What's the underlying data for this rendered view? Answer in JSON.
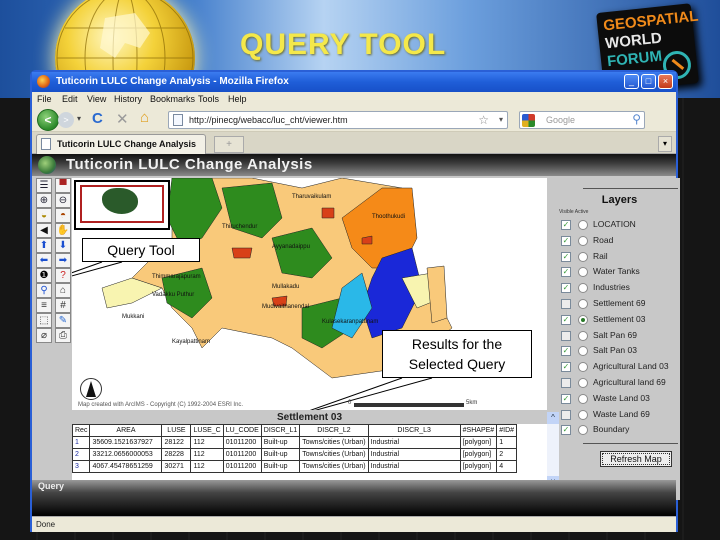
{
  "slide": {
    "title": "QUERY TOOL",
    "logo_lines": [
      "GEOSPATIAL",
      "WORLD",
      "FORUM"
    ],
    "colors": {
      "title": "#f4e84a",
      "logo_geo": "#f08a1a",
      "logo_world": "#e8e8e8",
      "logo_forum": "#2fb4b4"
    }
  },
  "browser": {
    "window_title": "Tuticorin LULC Change Analysis - Mozilla Firefox",
    "window_buttons": [
      "_",
      "□",
      "×"
    ],
    "menu": [
      "File",
      "Edit",
      "View",
      "History",
      "Bookmarks",
      "Tools",
      "Help"
    ],
    "nav": {
      "back": "<",
      "forward": ">",
      "dropdown": "▾",
      "reload": "C",
      "stop": "✕",
      "home": "⌂"
    },
    "url": "http://pinecg/webacc/luc_cht/viewer.htm",
    "bookmark_star": "☆",
    "search_placeholder": "Google",
    "tab_label": "Tuticorin LULC Change Analysis",
    "new_tab": "+",
    "tab_list": "▾",
    "status": "Done"
  },
  "app": {
    "title": "Tuticorin LULC Change Analysis",
    "footer_label": "Query",
    "toolbar": [
      {
        "name": "legend-toggle-icon",
        "glyph": "☰"
      },
      {
        "name": "overview-toggle-icon",
        "glyph": "▀"
      },
      {
        "name": "zoom-in-icon",
        "glyph": "⊕"
      },
      {
        "name": "zoom-out-icon",
        "glyph": "⊖"
      },
      {
        "name": "zoom-full-icon",
        "glyph": "◒"
      },
      {
        "name": "zoom-active-icon",
        "glyph": "◓"
      },
      {
        "name": "back-extent-icon",
        "glyph": "◀"
      },
      {
        "name": "pan-hand-icon",
        "glyph": "✋"
      },
      {
        "name": "pan-north-icon",
        "glyph": "⬆"
      },
      {
        "name": "pan-south-icon",
        "glyph": "⬇"
      },
      {
        "name": "pan-west-icon",
        "glyph": "⬅"
      },
      {
        "name": "pan-east-icon",
        "glyph": "➡"
      },
      {
        "name": "identify-icon",
        "glyph": "❶"
      },
      {
        "name": "query-tool-icon",
        "glyph": "?"
      },
      {
        "name": "find-binoculars-icon",
        "glyph": "⚲"
      },
      {
        "name": "measure-icon",
        "glyph": "⌂"
      },
      {
        "name": "buffer-icon",
        "glyph": "≡"
      },
      {
        "name": "grid-icon",
        "glyph": "#"
      },
      {
        "name": "select-rect-icon",
        "glyph": "⬚"
      },
      {
        "name": "select-line-icon",
        "glyph": "✎"
      },
      {
        "name": "clear-selection-icon",
        "glyph": "⌀"
      },
      {
        "name": "print-icon",
        "glyph": "⎙"
      }
    ],
    "map": {
      "callout_query": "Query Tool",
      "callout_results_line1": "Results for the",
      "callout_results_line2": "Selected Query",
      "copyright": "Map created with ArcIMS - Copyright (C) 1992-2004 ESRI Inc.",
      "scale_start": "0",
      "scale_end": "5km",
      "place_labels": [
        "Tharuvaikulam",
        "Thiruchendur",
        "Ayyanadaippu",
        "Thoothukudi",
        "Mullakadu",
        "Thimmarajapuram",
        "Vadakku Puthur",
        "Mudivaithanendal",
        "Mukkani",
        "Kulasekaranpattinam",
        "Kayalpattinam"
      ],
      "land_colors": {
        "agriculture": "#f9c97a",
        "vegetation": "#2e8b1e",
        "settlement": "#d84018",
        "water": "#2ab8e8",
        "industrial": "#f58a18",
        "saltpan": "#1a28d8",
        "wasteland": "#f8f4b0"
      }
    },
    "layers": {
      "title": "Layers",
      "subheader": "Visible Active",
      "items": [
        {
          "label": "LOCATION",
          "visible": true,
          "active": false
        },
        {
          "label": "Road",
          "visible": true,
          "active": false
        },
        {
          "label": "Rail",
          "visible": true,
          "active": false
        },
        {
          "label": "Water Tanks",
          "visible": true,
          "active": false
        },
        {
          "label": "Industries",
          "visible": true,
          "active": false
        },
        {
          "label": "Settlement 69",
          "visible": false,
          "active": false
        },
        {
          "label": "Settlement 03",
          "visible": true,
          "active": true
        },
        {
          "label": "Salt Pan 69",
          "visible": false,
          "active": false
        },
        {
          "label": "Salt Pan 03",
          "visible": true,
          "active": false
        },
        {
          "label": "Agricultural Land 03",
          "visible": true,
          "active": false
        },
        {
          "label": "Agricultural land 69",
          "visible": false,
          "active": false
        },
        {
          "label": "Waste Land 03",
          "visible": true,
          "active": false
        },
        {
          "label": "Waste Land 69",
          "visible": false,
          "active": false
        },
        {
          "label": "Boundary",
          "visible": true,
          "active": false
        }
      ],
      "refresh_label": "Refresh Map"
    },
    "results": {
      "title": "Settlement 03",
      "columns": [
        "Rec",
        "AREA",
        "LUSE",
        "LUSE_C",
        "LU_CODE",
        "DISCR_L1",
        "DISCR_L2",
        "DISCR_L3",
        "#SHAPE#",
        "#ID#"
      ],
      "rows": [
        [
          "1",
          "35609.1521637927",
          "28122",
          "112",
          "01011200",
          "Built-up",
          "Towns/cities (Urban)",
          "Industrial",
          "[polygon]",
          "1"
        ],
        [
          "2",
          "33212.0656000053",
          "28228",
          "112",
          "01011200",
          "Built-up",
          "Towns/cities (Urban)",
          "Industrial",
          "[polygon]",
          "2"
        ],
        [
          "3",
          "4067.45478651259",
          "30271",
          "112",
          "01011200",
          "Built-up",
          "Towns/cities (Urban)",
          "Industrial",
          "[polygon]",
          "4"
        ]
      ],
      "scroll_left": "<",
      "scroll_right": ">",
      "scroll_up": "^",
      "scroll_down": "v"
    }
  }
}
